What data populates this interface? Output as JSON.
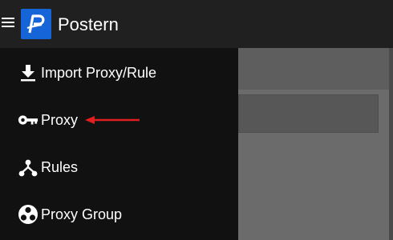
{
  "app": {
    "title": "Postern",
    "logo_icon": "postern-p-logo",
    "brand_color": "#1565d8"
  },
  "drawer": {
    "items": [
      {
        "label": "Import Proxy/Rule",
        "icon": "download-icon"
      },
      {
        "label": "Proxy",
        "icon": "key-icon"
      },
      {
        "label": "Rules",
        "icon": "fork-icon"
      },
      {
        "label": "Proxy Group",
        "icon": "group-icon"
      }
    ]
  },
  "annotation": {
    "color": "#e02020",
    "points_to": "Proxy"
  }
}
